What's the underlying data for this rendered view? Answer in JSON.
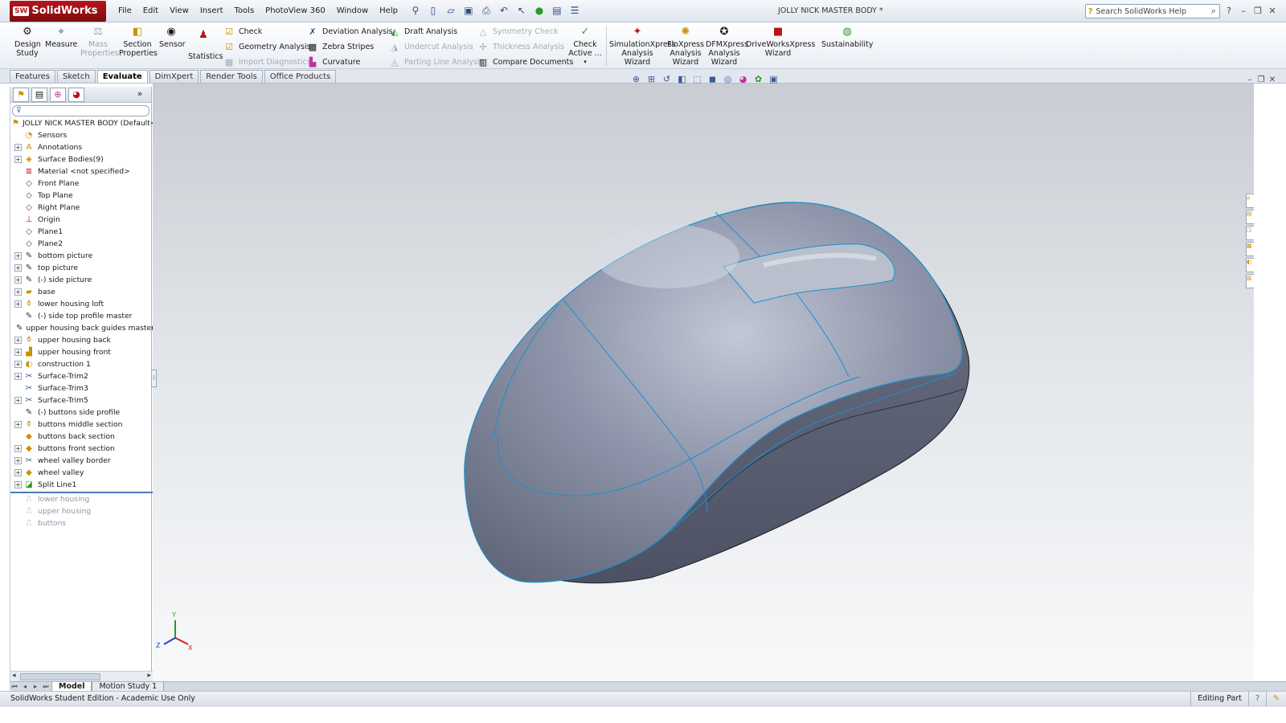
{
  "app": {
    "logo_text": "SolidWorks",
    "logo_badge": "SW",
    "menus": [
      "File",
      "Edit",
      "View",
      "Insert",
      "Tools",
      "PhotoView 360",
      "Window",
      "Help"
    ],
    "document_title": "JOLLY NICK MASTER BODY *",
    "search_placeholder": "Search SolidWorks Help"
  },
  "command_manager": {
    "design_study": "Design Study",
    "measure": "Measure",
    "mass_properties": "Mass Properties",
    "section_properties": "Section Properties",
    "sensor": "Sensor",
    "statistics": "Statistics",
    "col1": [
      "Check",
      "Geometry Analysis",
      "Import Diagnostics"
    ],
    "col2": [
      "Deviation Analysis",
      "Zebra Stripes",
      "Curvature"
    ],
    "col3": [
      "Draft Analysis",
      "Undercut Analysis",
      "Parting Line Analysis"
    ],
    "col4": [
      "Symmetry Check",
      "Thickness Analysis",
      "Compare Documents"
    ],
    "check_active": "Check Active ...",
    "simulationxpress": "SimulationXpress Analysis Wizard",
    "floxpress": "FloXpress Analysis Wizard",
    "dfmxpress": "DFMXpress Analysis Wizard",
    "driveworksxpress": "DriveWorksXpress Wizard",
    "sustainability": "Sustainability"
  },
  "tabs": [
    "Features",
    "Sketch",
    "Evaluate",
    "DimXpert",
    "Render Tools",
    "Office Products"
  ],
  "active_tab": "Evaluate",
  "feature_tree": {
    "root": "JOLLY NICK MASTER BODY  (Default<<",
    "items": [
      {
        "label": "Sensors",
        "icon": "sensor-icon",
        "expandable": false
      },
      {
        "label": "Annotations",
        "icon": "annotation-icon",
        "expandable": true
      },
      {
        "label": "Surface Bodies(9)",
        "icon": "surface-bodies-icon",
        "expandable": true
      },
      {
        "label": "Material <not specified>",
        "icon": "material-icon",
        "expandable": false
      },
      {
        "label": "Front Plane",
        "icon": "plane-icon",
        "expandable": false
      },
      {
        "label": "Top Plane",
        "icon": "plane-icon",
        "expandable": false
      },
      {
        "label": "Right Plane",
        "icon": "plane-icon",
        "expandable": false
      },
      {
        "label": "Origin",
        "icon": "origin-icon",
        "expandable": false
      },
      {
        "label": "Plane1",
        "icon": "plane-icon",
        "expandable": false
      },
      {
        "label": "Plane2",
        "icon": "plane-icon",
        "expandable": false
      },
      {
        "label": "bottom picture",
        "icon": "sketch-icon",
        "expandable": true
      },
      {
        "label": "top picture",
        "icon": "sketch-icon",
        "expandable": true
      },
      {
        "label": "(-) side picture",
        "icon": "sketch-icon",
        "expandable": true
      },
      {
        "label": "base",
        "icon": "surface-icon",
        "expandable": true
      },
      {
        "label": "lower housing loft",
        "icon": "loft-icon",
        "expandable": true
      },
      {
        "label": "(-) side top profile master",
        "icon": "sketch-icon",
        "expandable": false
      },
      {
        "label": "upper housing back guides master",
        "icon": "sketch-icon",
        "expandable": false
      },
      {
        "label": "upper housing back",
        "icon": "loft-icon",
        "expandable": true
      },
      {
        "label": "upper housing front",
        "icon": "boundary-icon",
        "expandable": true
      },
      {
        "label": "construction 1",
        "icon": "construction-icon",
        "expandable": true
      },
      {
        "label": "Surface-Trim2",
        "icon": "trim-icon",
        "expandable": true
      },
      {
        "label": "Surface-Trim3",
        "icon": "trim-icon",
        "expandable": false
      },
      {
        "label": "Surface-Trim5",
        "icon": "trim-icon",
        "expandable": true
      },
      {
        "label": "(-) buttons side profile",
        "icon": "sketch-icon",
        "expandable": false
      },
      {
        "label": "buttons middle section",
        "icon": "loft-icon",
        "expandable": true
      },
      {
        "label": "buttons back section",
        "icon": "fill-icon",
        "expandable": false
      },
      {
        "label": "buttons front section",
        "icon": "fill-icon",
        "expandable": true
      },
      {
        "label": "wheel valley border",
        "icon": "trim-icon",
        "expandable": true
      },
      {
        "label": "wheel valley",
        "icon": "fill-icon",
        "expandable": true
      },
      {
        "label": "Split Line1",
        "icon": "split-line-icon",
        "expandable": true
      }
    ],
    "suppressed": [
      {
        "label": "lower housing",
        "icon": "body-icon"
      },
      {
        "label": "upper housing",
        "icon": "body-icon"
      },
      {
        "label": "buttons",
        "icon": "body-icon"
      }
    ]
  },
  "bottom_tabs": [
    "Model",
    "Motion Study 1"
  ],
  "active_bottom_tab": "Model",
  "status": {
    "left": "SolidWorks Student Edition - Academic Use Only",
    "mode": "Editing Part"
  },
  "colors": {
    "model_body": "#8a91a6",
    "model_edge": "#1a8fd0",
    "brand": "#b9141a"
  }
}
